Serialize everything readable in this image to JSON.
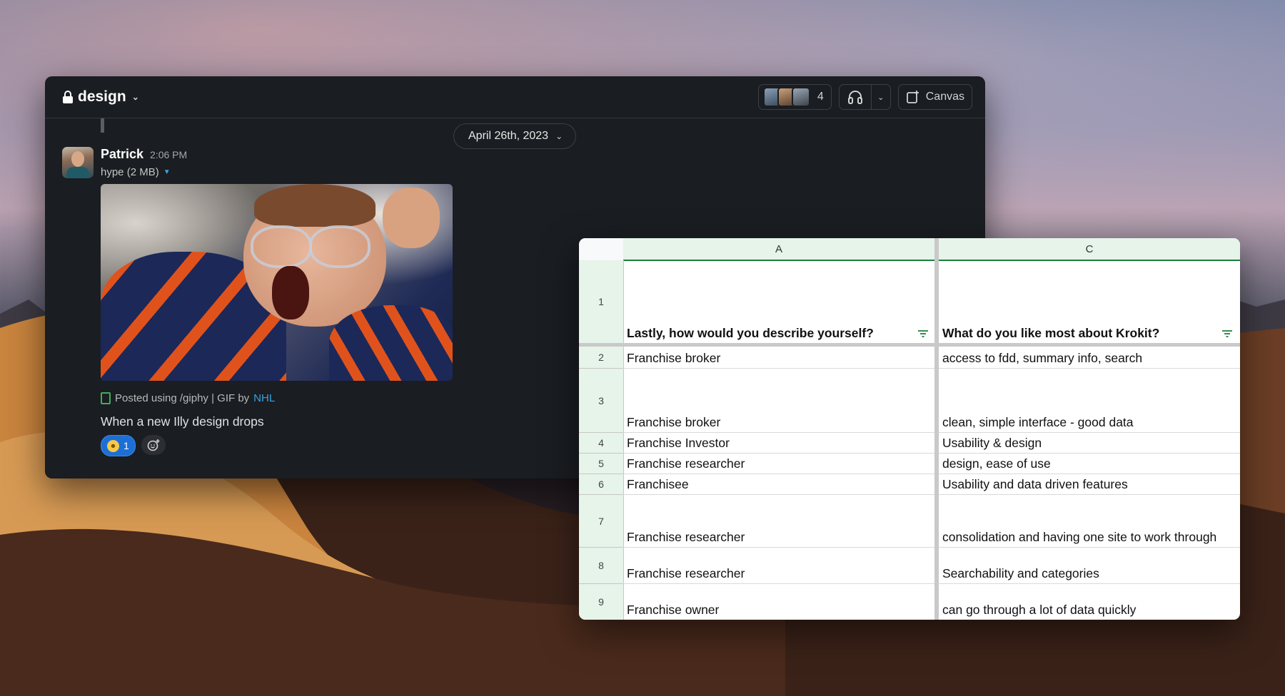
{
  "slack": {
    "channel_name": "design",
    "member_count": "4",
    "canvas_label": "Canvas",
    "date_divider": "April 26th, 2023",
    "message": {
      "sender": "Patrick",
      "time": "2:06 PM",
      "file_label": "hype (2 MB)",
      "giphy_prefix": "Posted using /giphy | GIF by",
      "giphy_source": "NHL",
      "text": "When a new Illy design drops",
      "reaction_count": "1"
    },
    "icons": [
      "lock-icon",
      "chevron-down-icon",
      "headphones-icon",
      "canvas-icon",
      "add-reaction-icon",
      "grinning-emoji"
    ]
  },
  "sheet": {
    "columns": [
      "A",
      "C"
    ],
    "header_row": {
      "row": "1",
      "a": "Lastly, how would you describe yourself?",
      "c": "What do you like most about Krokit?"
    },
    "rows": [
      {
        "row": "2",
        "a": "Franchise broker",
        "c": "access to fdd, summary info, search"
      },
      {
        "row": "3",
        "a": "Franchise broker",
        "c": "clean, simple interface - good data"
      },
      {
        "row": "4",
        "a": "Franchise Investor",
        "c": "Usability & design"
      },
      {
        "row": "5",
        "a": "Franchise researcher",
        "c": "design, ease of use"
      },
      {
        "row": "6",
        "a": "Franchisee",
        "c": "Usability and data driven features"
      },
      {
        "row": "7",
        "a": "Franchise researcher",
        "c": "consolidation and having one site to work through"
      },
      {
        "row": "8",
        "a": "Franchise researcher",
        "c": "Searchability and categories"
      },
      {
        "row": "9",
        "a": "Franchise owner",
        "c": "can go through a lot of data quickly"
      }
    ],
    "header_color": "#e6f4ea",
    "accent_color": "#188038"
  }
}
